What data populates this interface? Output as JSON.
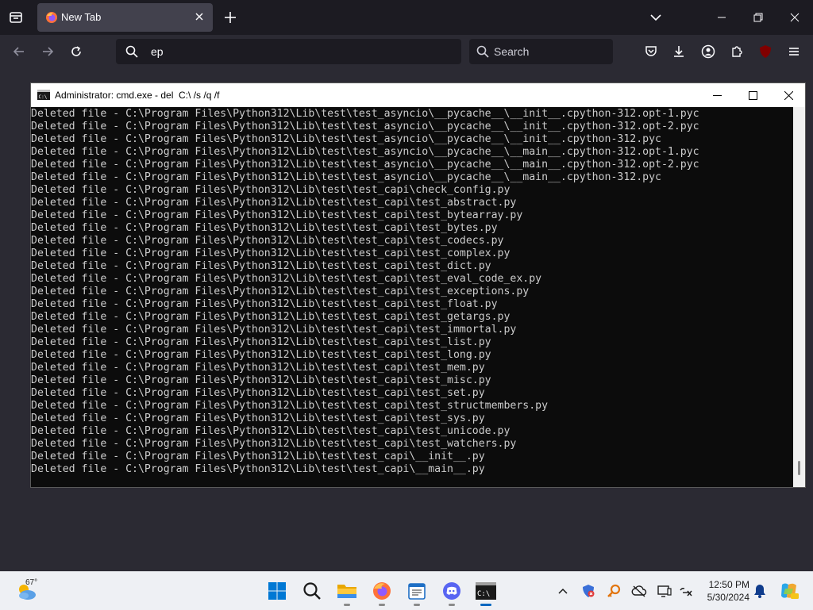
{
  "browser": {
    "tab_title": "New Tab",
    "url_text": "ep",
    "search_placeholder": "Search",
    "ublock_badge": "uo"
  },
  "cmd": {
    "title": "Administrator: cmd.exe - del  C:\\ /s /q /f",
    "lines": [
      "Deleted file - C:\\Program Files\\Python312\\Lib\\test\\test_asyncio\\__pycache__\\__init__.cpython-312.opt-1.pyc",
      "Deleted file - C:\\Program Files\\Python312\\Lib\\test\\test_asyncio\\__pycache__\\__init__.cpython-312.opt-2.pyc",
      "Deleted file - C:\\Program Files\\Python312\\Lib\\test\\test_asyncio\\__pycache__\\__init__.cpython-312.pyc",
      "Deleted file - C:\\Program Files\\Python312\\Lib\\test\\test_asyncio\\__pycache__\\__main__.cpython-312.opt-1.pyc",
      "Deleted file - C:\\Program Files\\Python312\\Lib\\test\\test_asyncio\\__pycache__\\__main__.cpython-312.opt-2.pyc",
      "Deleted file - C:\\Program Files\\Python312\\Lib\\test\\test_asyncio\\__pycache__\\__main__.cpython-312.pyc",
      "Deleted file - C:\\Program Files\\Python312\\Lib\\test\\test_capi\\check_config.py",
      "Deleted file - C:\\Program Files\\Python312\\Lib\\test\\test_capi\\test_abstract.py",
      "Deleted file - C:\\Program Files\\Python312\\Lib\\test\\test_capi\\test_bytearray.py",
      "Deleted file - C:\\Program Files\\Python312\\Lib\\test\\test_capi\\test_bytes.py",
      "Deleted file - C:\\Program Files\\Python312\\Lib\\test\\test_capi\\test_codecs.py",
      "Deleted file - C:\\Program Files\\Python312\\Lib\\test\\test_capi\\test_complex.py",
      "Deleted file - C:\\Program Files\\Python312\\Lib\\test\\test_capi\\test_dict.py",
      "Deleted file - C:\\Program Files\\Python312\\Lib\\test\\test_capi\\test_eval_code_ex.py",
      "Deleted file - C:\\Program Files\\Python312\\Lib\\test\\test_capi\\test_exceptions.py",
      "Deleted file - C:\\Program Files\\Python312\\Lib\\test\\test_capi\\test_float.py",
      "Deleted file - C:\\Program Files\\Python312\\Lib\\test\\test_capi\\test_getargs.py",
      "Deleted file - C:\\Program Files\\Python312\\Lib\\test\\test_capi\\test_immortal.py",
      "Deleted file - C:\\Program Files\\Python312\\Lib\\test\\test_capi\\test_list.py",
      "Deleted file - C:\\Program Files\\Python312\\Lib\\test\\test_capi\\test_long.py",
      "Deleted file - C:\\Program Files\\Python312\\Lib\\test\\test_capi\\test_mem.py",
      "Deleted file - C:\\Program Files\\Python312\\Lib\\test\\test_capi\\test_misc.py",
      "Deleted file - C:\\Program Files\\Python312\\Lib\\test\\test_capi\\test_set.py",
      "Deleted file - C:\\Program Files\\Python312\\Lib\\test\\test_capi\\test_structmembers.py",
      "Deleted file - C:\\Program Files\\Python312\\Lib\\test\\test_capi\\test_sys.py",
      "Deleted file - C:\\Program Files\\Python312\\Lib\\test\\test_capi\\test_unicode.py",
      "Deleted file - C:\\Program Files\\Python312\\Lib\\test\\test_capi\\test_watchers.py",
      "Deleted file - C:\\Program Files\\Python312\\Lib\\test\\test_capi\\__init__.py",
      "Deleted file - C:\\Program Files\\Python312\\Lib\\test\\test_capi\\__main__.py"
    ]
  },
  "taskbar": {
    "temperature": "67°",
    "time": "12:50 PM",
    "date": "5/30/2024",
    "apps": [
      "windows-start",
      "search",
      "file-explorer",
      "firefox",
      "notepad",
      "discord",
      "command-prompt"
    ]
  },
  "colors": {
    "browser_bg": "#2b2a33",
    "console_bg": "#0c0c0c",
    "console_text": "#cccccc",
    "accent": "#0067c0"
  }
}
